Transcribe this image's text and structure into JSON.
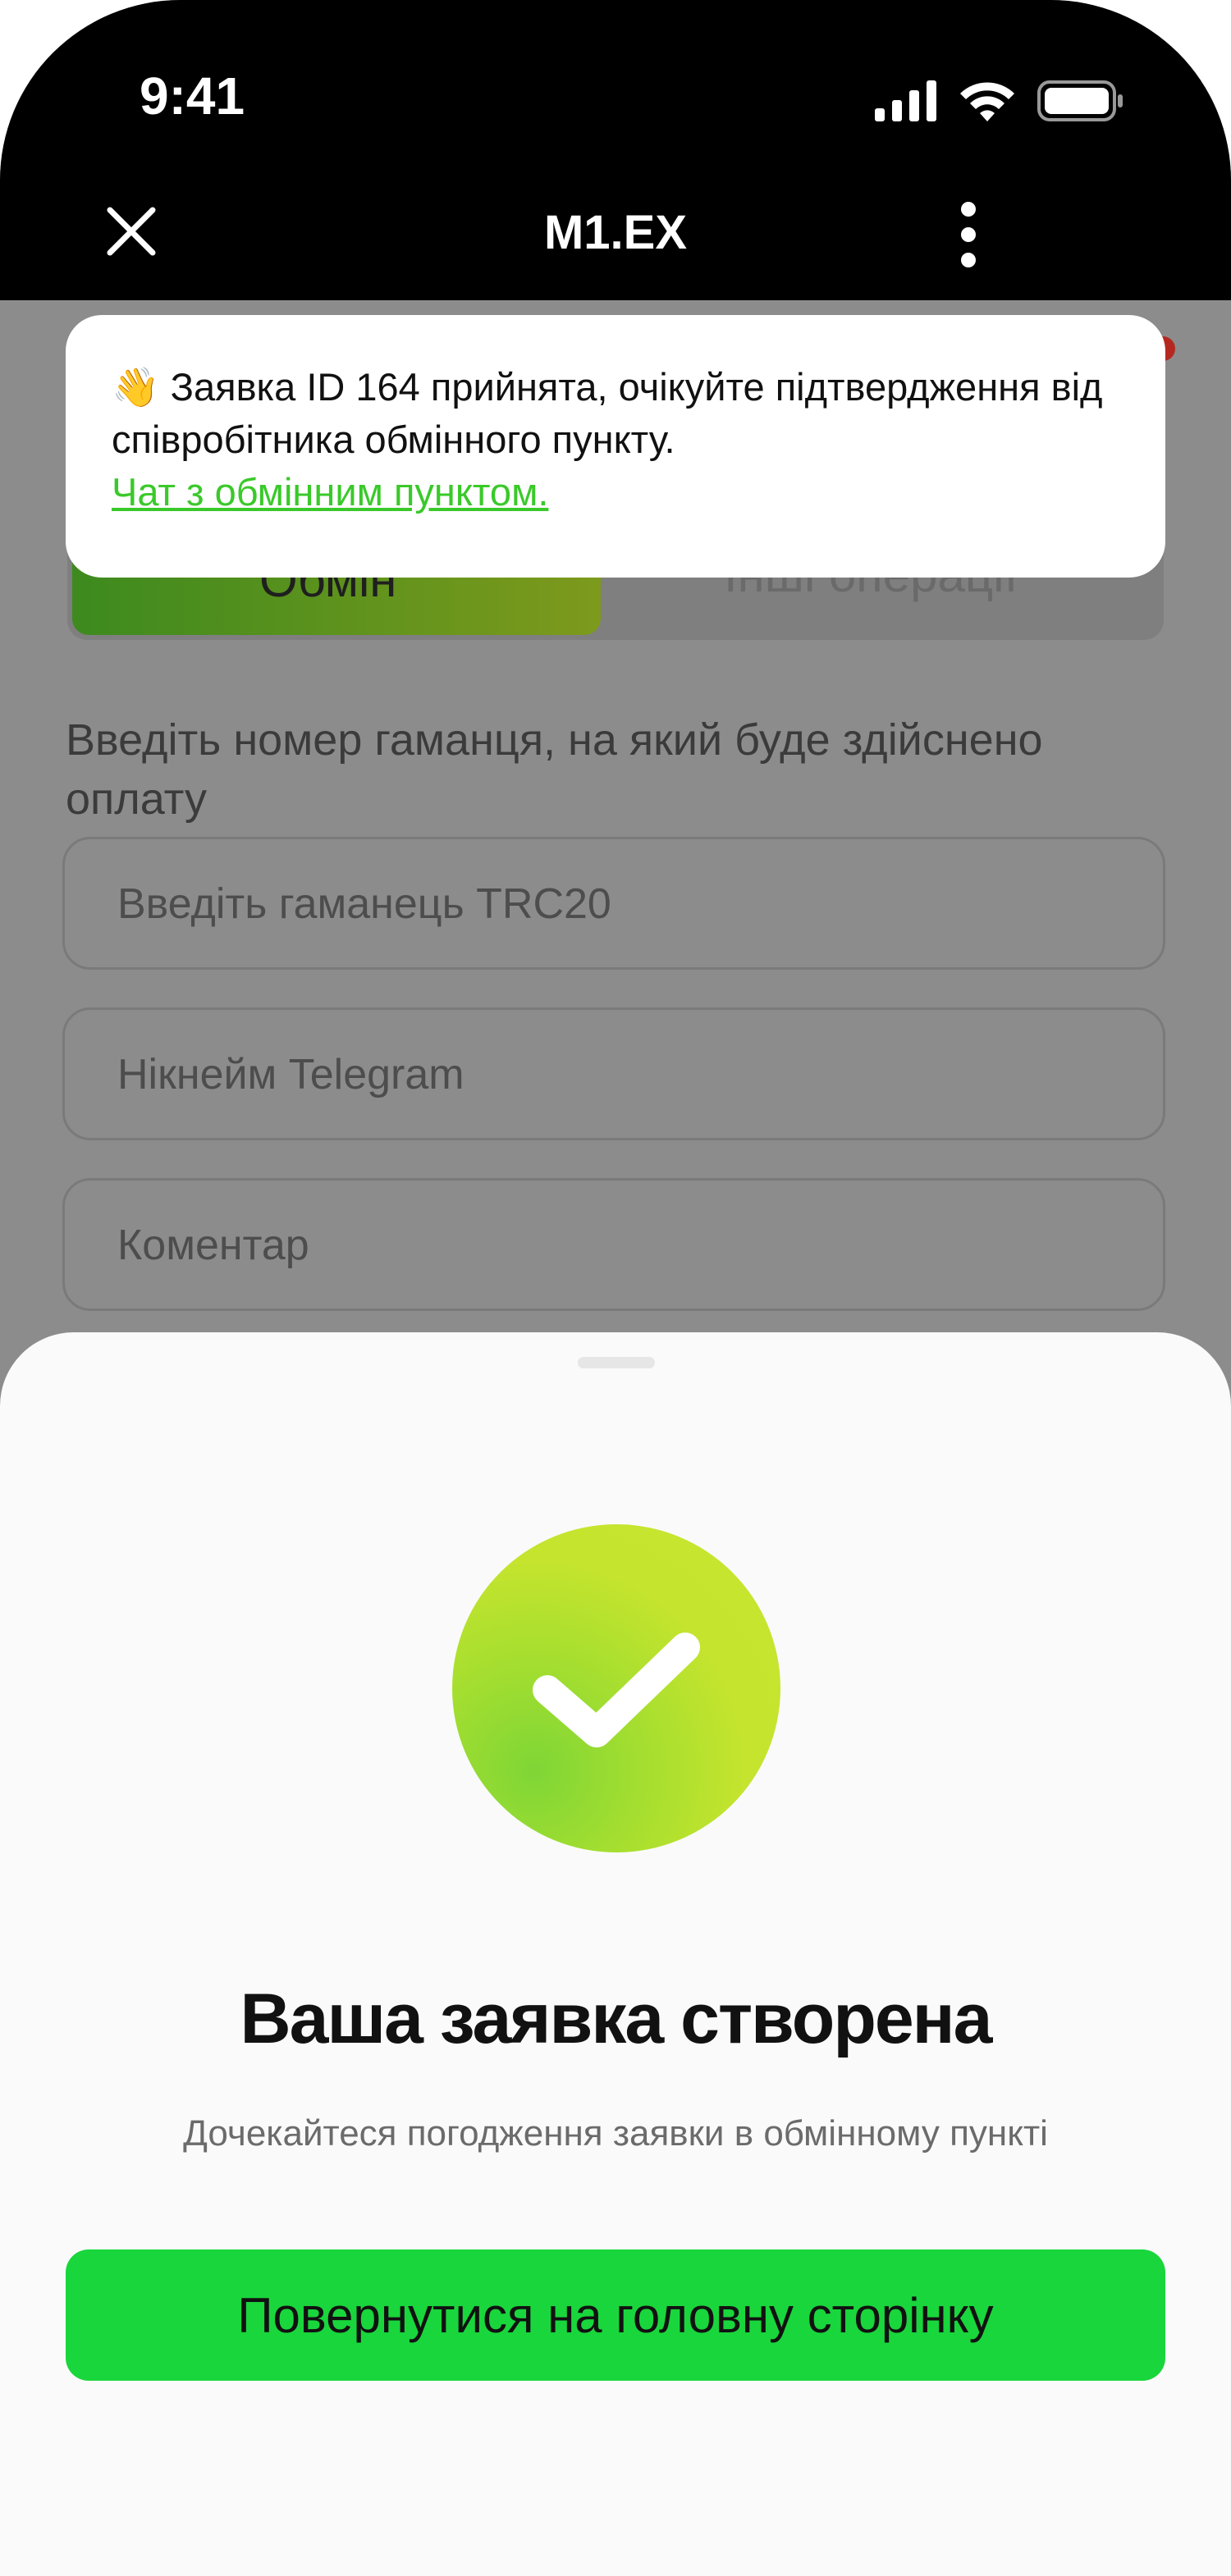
{
  "status_bar": {
    "time": "9:41",
    "icons": [
      "signal-icon",
      "wifi-icon",
      "battery-icon"
    ]
  },
  "header": {
    "title": "M1.EX"
  },
  "notification": {
    "emoji": "👋",
    "message": "Заявка ID 164 прийнята, очікуйте підтвердження від співробітника обмінного пункту.",
    "link": "Чат з обмінним пунктом."
  },
  "tabs": [
    {
      "label": "Обмін",
      "active": true
    },
    {
      "label": "Інші операції",
      "active": false
    }
  ],
  "wallet_prompt": "Введіть номер гаманця, на який буде здійснено оплату",
  "fields": [
    {
      "placeholder": "Введіть гаманець TRC20",
      "value": ""
    },
    {
      "placeholder": "Нікнейм Telegram",
      "value": ""
    },
    {
      "placeholder": "Коментар",
      "value": ""
    }
  ],
  "sheet": {
    "title": "Ваша заявка створена",
    "subtitle": "Дочекайтеся погодження заявки в обмінному пункті",
    "button_label": "Повернутися на головну сторінку"
  },
  "colors": {
    "accent_green": "#19d63c",
    "link_green": "#3ac92a",
    "check_gradient_start": "#7fd636",
    "check_gradient_end": "#c9e62f"
  }
}
